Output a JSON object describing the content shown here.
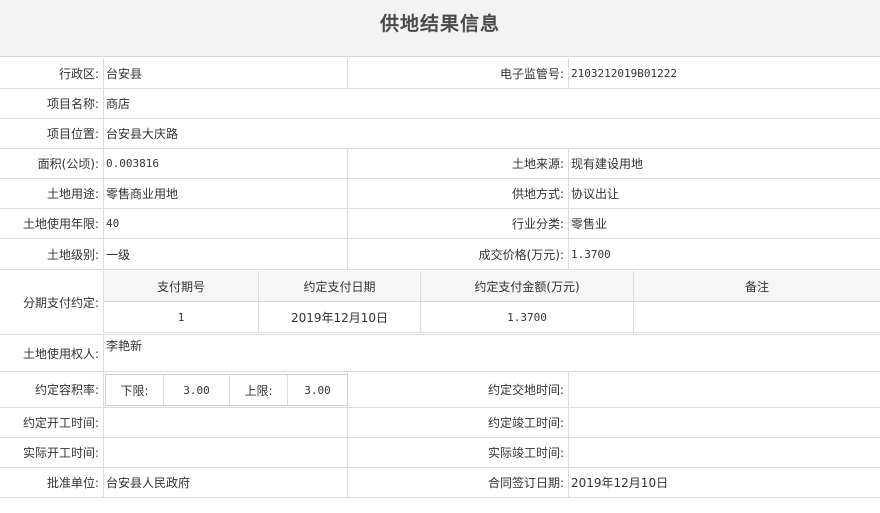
{
  "page_title": "供地结果信息",
  "fields": {
    "district_label": "行政区:",
    "district_value": "台安县",
    "supervision_no_label": "电子监管号:",
    "supervision_no_value": "2103212019B01222",
    "project_name_label": "项目名称:",
    "project_name_value": "商店",
    "project_location_label": "项目位置:",
    "project_location_value": "台安县大庆路",
    "area_label": "面积(公顷):",
    "area_value": "0.003816",
    "land_source_label": "土地来源:",
    "land_source_value": "现有建设用地",
    "land_use_label": "土地用途:",
    "land_use_value": "零售商业用地",
    "supply_method_label": "供地方式:",
    "supply_method_value": "协议出让",
    "use_years_label": "土地使用年限:",
    "use_years_value": "40",
    "industry_label": "行业分类:",
    "industry_value": "零售业",
    "land_grade_label": "土地级别:",
    "land_grade_value": "一级",
    "deal_price_label": "成交价格(万元):",
    "deal_price_value": "1.3700",
    "installment_label": "分期支付约定:",
    "land_user_label": "土地使用权人:",
    "land_user_value": "李艳新",
    "far_label": "约定容积率:",
    "handover_time_label": "约定交地时间:",
    "handover_time_value": "",
    "start_time_label": "约定开工时间:",
    "start_time_value": "",
    "completion_time_label": "约定竣工时间:",
    "completion_time_value": "",
    "actual_start_label": "实际开工时间:",
    "actual_start_value": "",
    "actual_completion_label": "实际竣工时间:",
    "actual_completion_value": "",
    "approval_unit_label": "批准单位:",
    "approval_unit_value": "台安县人民政府",
    "contract_date_label": "合同签订日期:",
    "contract_date_value": "2019年12月10日"
  },
  "installments": {
    "headers": [
      "支付期号",
      "约定支付日期",
      "约定支付金额(万元)",
      "备注"
    ],
    "rows": [
      [
        "1",
        "2019年12月10日",
        "1.3700",
        ""
      ]
    ]
  },
  "far": {
    "lower_label": "下限:",
    "lower_value": "3.00",
    "upper_label": "上限:",
    "upper_value": "3.00"
  }
}
